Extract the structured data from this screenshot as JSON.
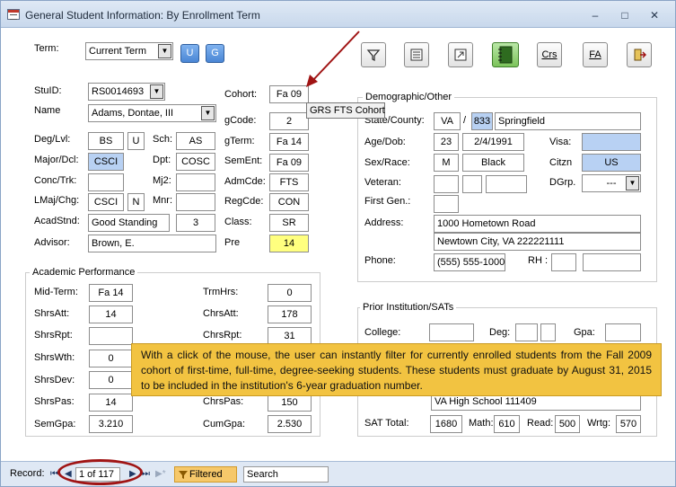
{
  "window": {
    "title": "General Student Information:  By Enrollment Term"
  },
  "top": {
    "term_label": "Term:",
    "term_value": "Current Term",
    "u_button": "U",
    "g_button": "G",
    "toolbar": [
      {
        "name": "filter-icon",
        "label": ""
      },
      {
        "name": "report-icon",
        "label": ""
      },
      {
        "name": "export-icon",
        "label": ""
      },
      {
        "name": "notebook-icon",
        "label": ""
      },
      {
        "name": "crs-icon",
        "label": "Crs"
      },
      {
        "name": "fa-icon",
        "label": "FA"
      },
      {
        "name": "exit-icon",
        "label": ""
      }
    ]
  },
  "student": {
    "stuid_label": "StuID:",
    "stuid_value": "RS0014693",
    "name_label": "Name",
    "name_value": "Adams, Dontae, III",
    "deglvl_label": "Deg/Lvl:",
    "deg_value": "BS",
    "lvl_value": "U",
    "sch_label": "Sch:",
    "sch_value": "AS",
    "majordcl_label": "Major/Dcl:",
    "major_value": "CSCI",
    "dpt_label": "Dpt:",
    "dpt_value": "COSC",
    "conctrk_label": "Conc/Trk:",
    "mj2_label": "Mj2:",
    "lmajchg_label": "LMaj/Chg:",
    "lmaj_value": "CSCI",
    "chg_value": "N",
    "mnr_label": "Mnr:",
    "acadstnd_label": "AcadStnd:",
    "acadstnd_value": "Good Standing",
    "acadstnd_num": "3",
    "advisor_label": "Advisor:",
    "advisor_value": "Brown, E."
  },
  "cohort": {
    "cohort_label": "Cohort:",
    "cohort_value": "Fa 09",
    "gcode_label": "gCode:",
    "gcode_value": "2",
    "gterm_label": "gTerm:",
    "gterm_value": "Fa 14",
    "sement_label": "SemEnt:",
    "sement_value": "Fa 09",
    "admcde_label": "AdmCde:",
    "admcde_value": "FTS",
    "regcde_label": "RegCde:",
    "regcde_value": "CON",
    "class_label": "Class:",
    "class_value": "SR",
    "pre_label": "Pre",
    "pre_value": "14",
    "tooltip": "GRS FTS Cohort"
  },
  "demographic": {
    "title": "Demographic/Other",
    "statecounty_label": "State/County:",
    "state_value": "VA",
    "slash": "/",
    "county_code": "833",
    "county_name": "Springfield",
    "agedob_label": "Age/Dob:",
    "age_value": "23",
    "dob_value": "2/4/1991",
    "visa_label": "Visa:",
    "sexrace_label": "Sex/Race:",
    "sex_value": "M",
    "race_value": "Black",
    "citzn_label": "Citzn",
    "citzn_value": "US",
    "veteran_label": "Veteran:",
    "dgrp_label": "DGrp.",
    "dgrp_value": "---",
    "firstgen_label": "First Gen.:",
    "address_label": "Address:",
    "address1": "1000 Hometown Road",
    "address2": "Newtown City, VA 222221111",
    "phone_label": "Phone:",
    "phone_value": "(555) 555-1000",
    "rh_label": "RH :"
  },
  "academic": {
    "title": "Academic Performance",
    "midterm_label": "Mid-Term:",
    "midterm_value": "Fa 14",
    "trmhrs_label": "TrmHrs:",
    "trmhrs_value": "0",
    "shrsatt_label": "ShrsAtt:",
    "shrsatt_value": "14",
    "chrsatt_label": "ChrsAtt:",
    "chrsatt_value": "178",
    "shrsrpt_label": "ShrsRpt:",
    "chrsrpt_label": "ChrsRpt:",
    "chrsrpt_value": "31",
    "shrswth_label": "ShrsWth:",
    "shrswth_value": "0",
    "shrsdev_label": "ShrsDev:",
    "shrsdev_value": "0",
    "shrspas_label": "ShrsPas:",
    "shrspas_value": "14",
    "chrspas_label": "ChrsPas:",
    "chrspas_value": "150",
    "semgpa_label": "SemGpa:",
    "semgpa_value": "3.210",
    "cumgpa_label": "CumGpa:",
    "cumgpa_value": "2.530"
  },
  "prior": {
    "title": "Prior Institution/SATs",
    "college_label": "College:",
    "deg_label": "Deg:",
    "gpa_label": "Gpa:",
    "highschool_value": "VA High School 111409",
    "sat_label": "SAT Total:",
    "sat_value": "1680",
    "math_label": "Math:",
    "math_value": "610",
    "read_label": "Read:",
    "read_value": "500",
    "wrtg_label": "Wrtg:",
    "wrtg_value": "570"
  },
  "callout": "With a click of the mouse, the user can instantly filter for currently enrolled students from the Fall 2009 cohort of first-time, full-time, degree-seeking students.  These students must graduate by August 31, 2015 to be included in the institution's 6-year graduation number.",
  "status": {
    "record_label": "Record:",
    "record_count": "1 of 117",
    "filtered_label": "Filtered",
    "search_label": "Search"
  },
  "colors": {
    "accent": "#b8d1f3",
    "callout": "#f2c341",
    "highlight": "#ffff7f",
    "annotation": "#a01414"
  }
}
